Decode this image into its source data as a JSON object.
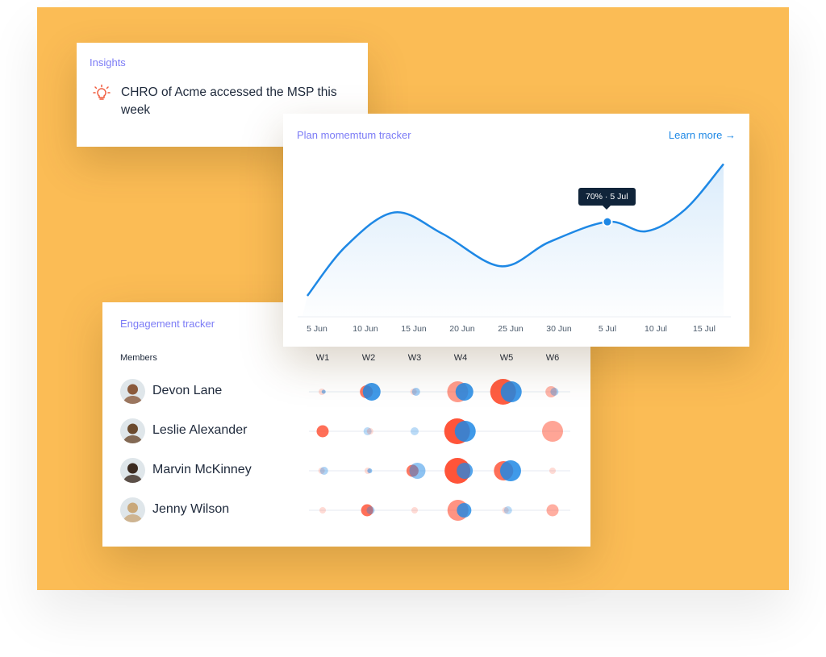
{
  "insights": {
    "label": "Insights",
    "icon": "lightbulb-icon",
    "message": "CHRO of Acme accessed the MSP this week"
  },
  "plan_tracker": {
    "title": "Plan momemtum tracker",
    "learn_more": "Learn more →",
    "tooltip": "70% · 5 Jul",
    "chart_data": {
      "type": "area",
      "x_ticks": [
        "5 Jun",
        "10 Jun",
        "15 Jun",
        "20 Jun",
        "25 Jun",
        "30 Jun",
        "5 Jul",
        "10 Jul",
        "15 Jul"
      ],
      "points": [
        {
          "date": "4 Jun",
          "value": 15
        },
        {
          "date": "8 Jun",
          "value": 52
        },
        {
          "date": "13 Jun",
          "value": 77
        },
        {
          "date": "18 Jun",
          "value": 61
        },
        {
          "date": "24 Jun",
          "value": 37
        },
        {
          "date": "29 Jun",
          "value": 55
        },
        {
          "date": "5 Jul",
          "value": 70
        },
        {
          "date": "9 Jul",
          "value": 63
        },
        {
          "date": "13 Jul",
          "value": 79
        },
        {
          "date": "17 Jul",
          "value": 113
        }
      ],
      "highlight": {
        "date": "5 Jul",
        "value": 70
      },
      "ylim": [
        0,
        115
      ],
      "grid": false,
      "line_color": "#1E88E5"
    }
  },
  "engagement": {
    "title": "Engagement tracker",
    "members_label": "Members",
    "weeks": [
      "W1",
      "W2",
      "W3",
      "W4",
      "W5",
      "W6"
    ],
    "colors": {
      "red": "#FF4B2E",
      "blue": "#1E88E5"
    },
    "members": [
      {
        "name": "Devon Lane",
        "avatar": "#8a5a3c",
        "bubbles": [
          [
            {
              "c": "red",
              "s": 4,
              "o": 0.2
            },
            {
              "c": "blue",
              "s": 2.5,
              "o": 0.5
            }
          ],
          [
            {
              "c": "red",
              "s": 8,
              "o": 0.75
            },
            {
              "c": "blue",
              "s": 11,
              "o": 0.85
            }
          ],
          [
            {
              "c": "red",
              "s": 4,
              "o": 0.2
            },
            {
              "c": "blue",
              "s": 5,
              "o": 0.4
            }
          ],
          [
            {
              "c": "red",
              "s": 13,
              "o": 0.55
            },
            {
              "c": "blue",
              "s": 11,
              "o": 0.85
            }
          ],
          [
            {
              "c": "red",
              "s": 16,
              "o": 0.9
            },
            {
              "c": "blue",
              "s": 13,
              "o": 0.85
            }
          ],
          [
            {
              "c": "red",
              "s": 7,
              "o": 0.4
            },
            {
              "c": "blue",
              "s": 5,
              "o": 0.35
            }
          ]
        ]
      },
      {
        "name": "Leslie Alexander",
        "avatar": "#6b4a2e",
        "bubbles": [
          [
            {
              "c": "red",
              "s": 7.5,
              "o": 0.8
            }
          ],
          [
            {
              "c": "blue",
              "s": 5,
              "o": 0.3
            },
            {
              "c": "red",
              "s": 4,
              "o": 0.2
            }
          ],
          [
            {
              "c": "blue",
              "s": 5,
              "o": 0.3
            }
          ],
          [
            {
              "c": "red",
              "s": 16,
              "o": 0.95
            },
            {
              "c": "blue",
              "s": 13,
              "o": 0.85
            }
          ],
          [],
          [
            {
              "c": "red",
              "s": 13,
              "o": 0.5
            }
          ]
        ]
      },
      {
        "name": "Marvin McKinney",
        "avatar": "#3b2a20",
        "bubbles": [
          [
            {
              "c": "red",
              "s": 4,
              "o": 0.2
            },
            {
              "c": "blue",
              "s": 5,
              "o": 0.35
            }
          ],
          [
            {
              "c": "red",
              "s": 4,
              "o": 0.2
            },
            {
              "c": "blue",
              "s": 3,
              "o": 0.5
            }
          ],
          [
            {
              "c": "red",
              "s": 7.5,
              "o": 0.75
            },
            {
              "c": "blue",
              "s": 10,
              "o": 0.5
            }
          ],
          [
            {
              "c": "red",
              "s": 16,
              "o": 0.95
            },
            {
              "c": "blue",
              "s": 10,
              "o": 0.75
            }
          ],
          [
            {
              "c": "red",
              "s": 12,
              "o": 0.8
            },
            {
              "c": "blue",
              "s": 13,
              "o": 0.85
            }
          ],
          [
            {
              "c": "red",
              "s": 4,
              "o": 0.2
            }
          ]
        ]
      },
      {
        "name": "Jenny Wilson",
        "avatar": "#c9a87a",
        "bubbles": [
          [
            {
              "c": "red",
              "s": 4,
              "o": 0.2
            }
          ],
          [
            {
              "c": "red",
              "s": 7.5,
              "o": 0.8
            },
            {
              "c": "blue",
              "s": 5,
              "o": 0.35
            }
          ],
          [
            {
              "c": "red",
              "s": 4,
              "o": 0.2
            }
          ],
          [
            {
              "c": "red",
              "s": 13,
              "o": 0.6
            },
            {
              "c": "blue",
              "s": 9,
              "o": 0.8
            }
          ],
          [
            {
              "c": "red",
              "s": 4,
              "o": 0.2
            },
            {
              "c": "blue",
              "s": 5,
              "o": 0.3
            }
          ],
          [
            {
              "c": "red",
              "s": 7.5,
              "o": 0.45
            }
          ]
        ]
      }
    ]
  }
}
